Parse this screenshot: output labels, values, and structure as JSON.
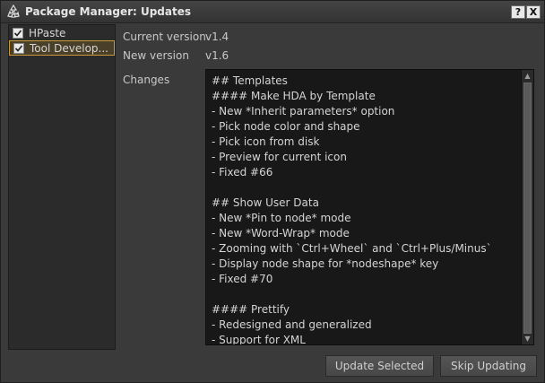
{
  "window": {
    "title": "Package Manager: Updates",
    "help_label": "?",
    "close_label": "X"
  },
  "packages": [
    {
      "label": "HPaste",
      "checked": true,
      "selected": false
    },
    {
      "label": "Tool Develop...",
      "checked": true,
      "selected": true
    }
  ],
  "details": {
    "current_version_label": "Current version",
    "current_version_value": "v1.4",
    "new_version_label": "New version",
    "new_version_value": "v1.6",
    "changes_label": "Changes",
    "changes_text": "## Templates\n#### Make HDA by Template\n- New *Inherit parameters* option\n- Pick node color and shape\n- Pick icon from disk\n- Preview for current icon\n- Fixed #66\n\n## Show User Data\n- New *Pin to node* mode\n- New *Word-Wrap* mode\n- Zooming with `Ctrl+Wheel` and `Ctrl+Plus/Minus`\n- Display node shape for *nodeshape* key\n- Fixed #70\n\n#### Prettify\n- Redesigned and generalized\n- Support for XML"
  },
  "actions": {
    "update_selected": "Update Selected",
    "skip_updating": "Skip Updating"
  },
  "colors": {
    "window_bg": "#3a3a3a",
    "selection_border": "#c89a3c",
    "text_area_bg": "#181818"
  }
}
